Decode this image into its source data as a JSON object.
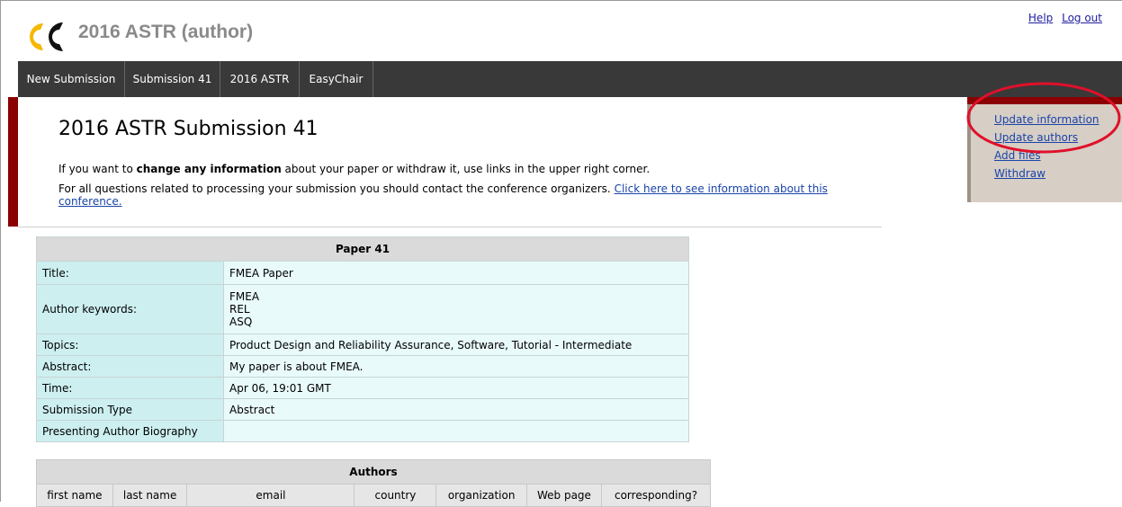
{
  "header": {
    "app_title": "2016 ASTR (author)",
    "help_label": "Help",
    "logout_label": "Log out"
  },
  "menu": {
    "items": [
      {
        "label": "New Submission"
      },
      {
        "label": "Submission 41"
      },
      {
        "label": "2016 ASTR"
      },
      {
        "label": "EasyChair"
      }
    ]
  },
  "sidebar": {
    "links": [
      {
        "label": "Update information"
      },
      {
        "label": "Update authors"
      },
      {
        "label": "Add files"
      },
      {
        "label": "Withdraw"
      }
    ]
  },
  "main": {
    "heading": "2016 ASTR Submission 41",
    "info1_pre": "If you want to ",
    "info1_bold": "change any information",
    "info1_post": " about your paper or withdraw it, use links in the upper right corner.",
    "info2_text": "For all questions related to processing your submission you should contact the conference organizers. ",
    "info2_link": "Click here to see information about this conference."
  },
  "paper": {
    "header": "Paper 41",
    "title_label": "Title:",
    "title_value": "FMEA Paper",
    "keywords_label": "Author keywords:",
    "keywords": [
      "FMEA",
      "REL",
      "ASQ"
    ],
    "topics_label": "Topics:",
    "topics_value": "Product Design and Reliability Assurance, Software, Tutorial - Intermediate",
    "abstract_label": "Abstract:",
    "abstract_value": "My paper is about FMEA.",
    "time_label": "Time:",
    "time_value": "Apr 06, 19:01 GMT",
    "subtype_label": "Submission Type",
    "subtype_value": "Abstract",
    "bio_label": "Presenting Author Biography",
    "bio_value": ""
  },
  "authors": {
    "header": "Authors",
    "columns": [
      "first name",
      "last name",
      "email",
      "country",
      "organization",
      "Web page",
      "corresponding?"
    ]
  },
  "colors": {
    "menu_bg": "#393939",
    "accent_red": "#8b0000",
    "sidebar_bg": "#d7cec5",
    "label_cell": "#cdeff0",
    "value_cell": "#e9fafb",
    "annotation": "#e0102a",
    "logo_yellow": "#f5b800"
  }
}
